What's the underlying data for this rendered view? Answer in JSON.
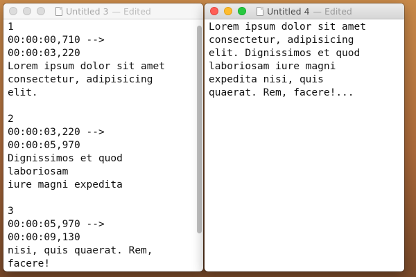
{
  "windows": [
    {
      "title": "Untitled 3",
      "state": "— Edited",
      "text": "1\n00:00:00,710 -->\n00:00:03,220\nLorem ipsum dolor sit amet\nconsectetur, adipisicing\nelit.\n\n2\n00:00:03,220 -->\n00:00:05,970\nDignissimos et quod\nlaboriosam\niure magni expedita\n\n3\n00:00:05,970 -->\n00:00:09,130\nnisi, quis quaerat. Rem,\nfacere!"
    },
    {
      "title": "Untitled 4",
      "state": "— Edited",
      "text": "Lorem ipsum dolor sit amet\nconsectetur, adipisicing\nelit. Dignissimos et quod\nlaboriosam iure magni\nexpedita nisi, quis\nquaerat. Rem, facere!..."
    }
  ]
}
